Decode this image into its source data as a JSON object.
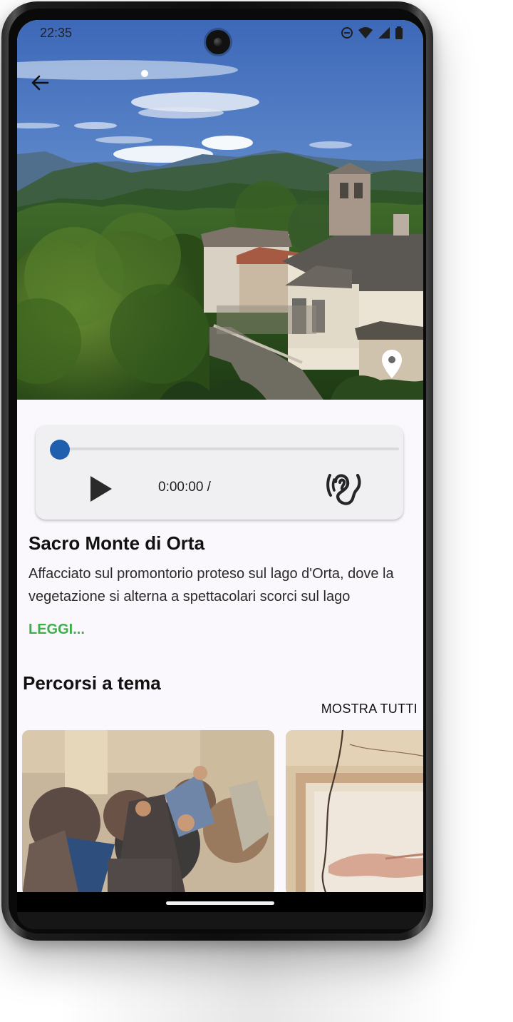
{
  "status_bar": {
    "time": "22:35",
    "icons": [
      "do-not-disturb-icon",
      "wifi-icon",
      "cellular-signal-icon",
      "battery-icon"
    ]
  },
  "header": {
    "back_icon": "arrow-left-icon",
    "map_icon": "map-pin-icon"
  },
  "audio_player": {
    "time_display": "0:00:00 /",
    "progress": 0,
    "accent_color": "#1f5fae",
    "play_icon": "play-icon",
    "accessibility_icon": "hearing-ear-icon"
  },
  "place": {
    "title": "Sacro Monte di Orta",
    "description": "Affacciato sul promontorio proteso sul lago d'Orta, dove la vegetazione si alterna a spettacolari scorci sul lago",
    "read_more": "LEGGI..."
  },
  "themed_routes": {
    "title": "Percorsi a tema",
    "show_all": "MOSTRA TUTTI"
  },
  "colors": {
    "read_more": "#3fae4a",
    "background": "#fbf8fd"
  }
}
